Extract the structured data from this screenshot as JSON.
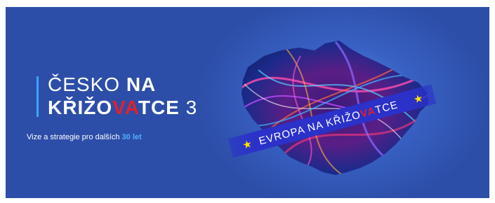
{
  "banner": {
    "title_line1_prefix": "ČESKO ",
    "title_line1_bold": "NA",
    "title_line2_a": "KŘIŽO",
    "title_line2_red": "VA",
    "title_line2_b": "TCE",
    "title_line2_num": " 3",
    "subtitle_prefix": "Vize a strategie pro dalších ",
    "subtitle_highlight": "30 let",
    "ribbon_prefix": "EVROPA NA KŘIŽO",
    "ribbon_red": "VA",
    "ribbon_suffix": "TCE",
    "star_icon": "★"
  },
  "colors": {
    "background": "#2d4ea8",
    "accent": "#3aa6ff",
    "red": "#e5202a",
    "ribbon": "#2b31c9",
    "star": "#ffe000"
  }
}
